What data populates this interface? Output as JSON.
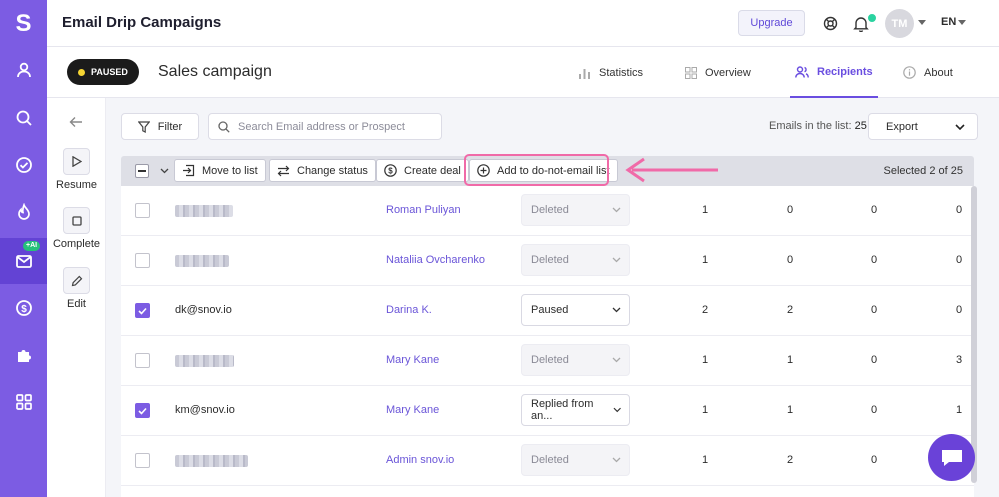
{
  "app": {
    "title": "Email Drip Campaigns",
    "upgrade_label": "Upgrade",
    "avatar_initials": "TM",
    "language": "EN"
  },
  "sidebar": {
    "logo": "S",
    "ai_badge": "+AI",
    "items": [
      "user-icon",
      "search-icon",
      "check-circle-icon",
      "flame-icon",
      "mail-icon",
      "dollar-icon",
      "puzzle-icon",
      "apps-icon"
    ]
  },
  "campaign": {
    "status_label": "PAUSED",
    "name": "Sales campaign",
    "tabs": [
      {
        "label": "Statistics"
      },
      {
        "label": "Overview"
      },
      {
        "label": "Recipients"
      },
      {
        "label": "About"
      }
    ],
    "active_tab": "Recipients"
  },
  "actions": {
    "resume": "Resume",
    "complete": "Complete",
    "edit": "Edit"
  },
  "list": {
    "filter_label": "Filter",
    "search_placeholder": "Search Email address or Prospect",
    "emails_count_label": "Emails in the list:",
    "emails_count": "25",
    "export_label": "Export"
  },
  "toolbar": {
    "move_label": "Move to list",
    "status_label": "Change status",
    "deal_label": "Create deal",
    "dne_label": "Add to do-not-email list",
    "selected_text": "Selected 2 of 25"
  },
  "rows": [
    {
      "checked": false,
      "email": "",
      "name": "Roman Puliyan",
      "status": "Deleted",
      "enabled": false,
      "c1": "1",
      "c2": "0",
      "c3": "0",
      "c4": "0"
    },
    {
      "checked": false,
      "email": "",
      "name": "Nataliia Ovcharenko",
      "status": "Deleted",
      "enabled": false,
      "c1": "1",
      "c2": "0",
      "c3": "0",
      "c4": "0"
    },
    {
      "checked": true,
      "email": "dk@snov.io",
      "name": "Darina K.",
      "status": "Paused",
      "enabled": true,
      "c1": "2",
      "c2": "2",
      "c3": "0",
      "c4": "0"
    },
    {
      "checked": false,
      "email": "",
      "name": "Mary Kane",
      "status": "Deleted",
      "enabled": false,
      "c1": "1",
      "c2": "1",
      "c3": "0",
      "c4": "3"
    },
    {
      "checked": true,
      "email": "km@snov.io",
      "name": "Mary Kane",
      "status": "Replied from an...",
      "enabled": true,
      "c1": "1",
      "c2": "1",
      "c3": "0",
      "c4": "1"
    },
    {
      "checked": false,
      "email": "",
      "name": "Admin snov.io",
      "status": "Deleted",
      "enabled": false,
      "c1": "1",
      "c2": "2",
      "c3": "0",
      "c4": ""
    }
  ],
  "colors": {
    "brand": "#7c5ce3",
    "accent": "#6a4ee0",
    "highlight": "#f06aa8",
    "paused_dot": "#f5d533",
    "notification_dot": "#2ad3a0"
  }
}
